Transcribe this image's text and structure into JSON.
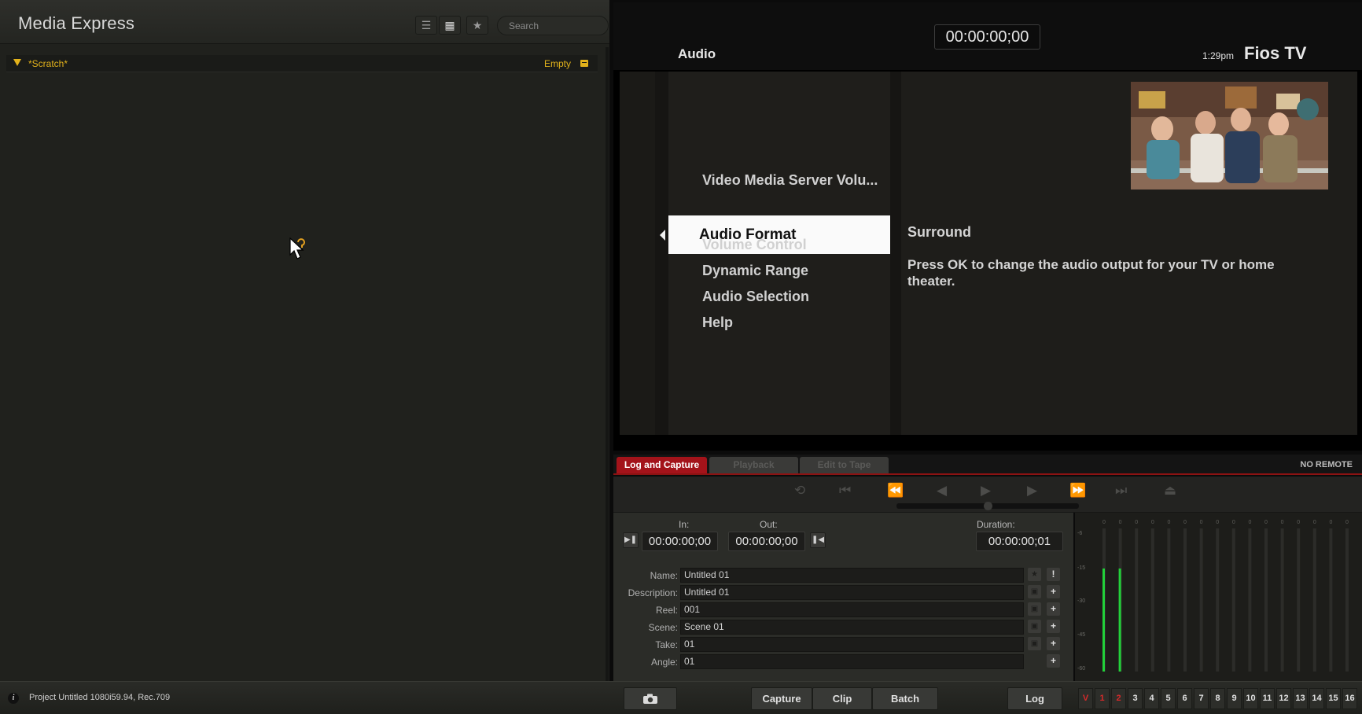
{
  "app": {
    "title": "Media Express"
  },
  "toolbar": {
    "search_placeholder": "Search"
  },
  "bin": {
    "name": "*Scratch*",
    "status": "Empty"
  },
  "preview": {
    "timecode": "00:00:00;00",
    "section_title": "Audio",
    "clock": "1:29pm",
    "brand": "Fios TV",
    "menu_items": [
      "Video Media Server Volu...",
      "Audio Format",
      "Volume Control",
      "Dynamic Range",
      "Audio Selection",
      "Help"
    ],
    "selected_item": "Audio Format",
    "selected_value": "Surround",
    "description": "Press OK to change the audio output for your TV or home theater."
  },
  "tabs": {
    "log_and_capture": "Log and Capture",
    "playback": "Playback",
    "edit_to_tape": "Edit to Tape",
    "remote_status": "NO REMOTE"
  },
  "log": {
    "in_label": "In:",
    "out_label": "Out:",
    "duration_label": "Duration:",
    "in_tc": "00:00:00;00",
    "out_tc": "00:00:00;00",
    "duration_tc": "00:00:00;01",
    "fields": [
      {
        "label": "Name:",
        "value": "Untitled 01"
      },
      {
        "label": "Description:",
        "value": "Untitled 01"
      },
      {
        "label": "Reel:",
        "value": "001"
      },
      {
        "label": "Scene:",
        "value": "Scene 01"
      },
      {
        "label": "Take:",
        "value": "01"
      },
      {
        "label": "Angle:",
        "value": "01"
      }
    ]
  },
  "meters": {
    "scale": [
      "-6",
      "-15",
      "-30",
      "-45",
      "-60"
    ],
    "channel_peak": [
      "0",
      "0",
      "0",
      "0",
      "0",
      "0",
      "0",
      "0",
      "0",
      "0",
      "0",
      "0",
      "0",
      "0",
      "0",
      "0"
    ],
    "levels": [
      0.72,
      0.72,
      0,
      0,
      0,
      0,
      0,
      0,
      0,
      0,
      0,
      0,
      0,
      0,
      0,
      0
    ],
    "active_color": "#22d13a"
  },
  "bottom": {
    "project_info": "Project Untitled  1080i59.94, Rec.709",
    "capture": "Capture",
    "clip": "Clip",
    "batch": "Batch",
    "log": "Log",
    "channels": [
      "V",
      "1",
      "2",
      "3",
      "4",
      "5",
      "6",
      "7",
      "8",
      "9",
      "10",
      "11",
      "12",
      "13",
      "14",
      "15",
      "16"
    ],
    "accent_red": "#d52a2a"
  }
}
